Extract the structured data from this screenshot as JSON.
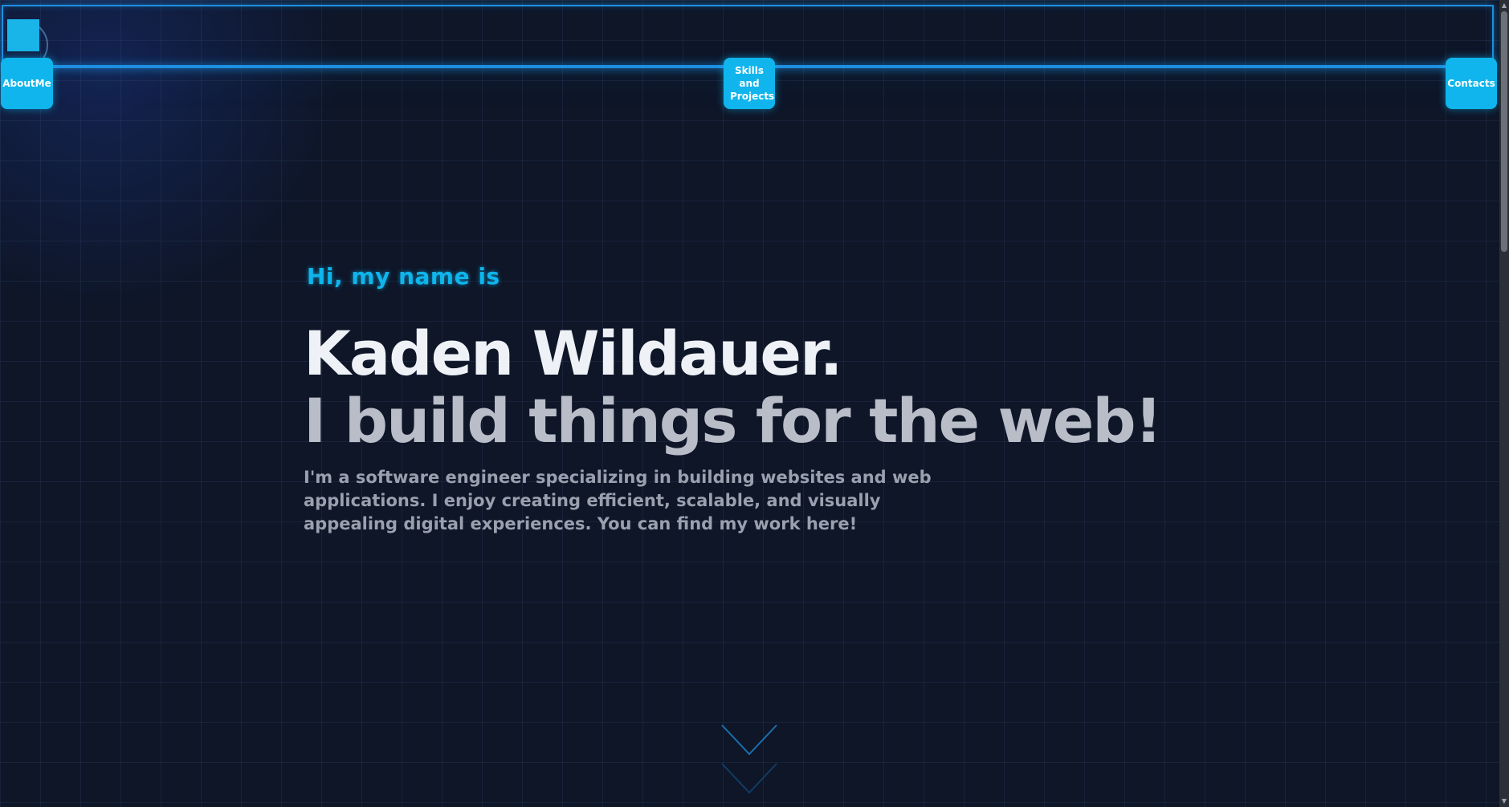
{
  "nav": {
    "about_label": "AboutMe",
    "skills_label_lines": [
      "Skills",
      "and",
      "Projects"
    ],
    "contacts_label": "Contacts"
  },
  "hero": {
    "greeting": "Hi, my name is",
    "name": "Kaden Wildauer.",
    "tagline": "I build things for the web!",
    "intro": "I'm a software engineer specializing in building websites and web applications. I enjoy creating efficient, scalable, and visually appealing digital experiences. You can find my work here!"
  },
  "colors": {
    "background": "#0e1628",
    "accent": "#0fb5ec",
    "frame": "#1e8fe0",
    "name_text": "#eef1f6",
    "tagline_text": "#b9bdc8",
    "intro_text": "#9aa0ad"
  },
  "icons": {
    "logo": "square-logo-icon",
    "scroll": "chevron-down-icon",
    "scrollbar_up": "scroll-up-arrow-icon",
    "scrollbar_down": "scroll-down-arrow-icon"
  }
}
